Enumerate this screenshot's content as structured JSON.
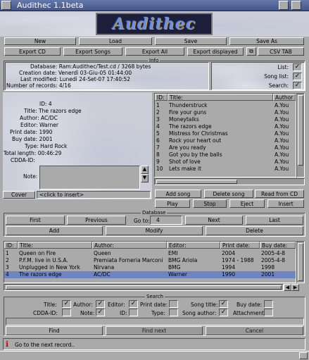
{
  "window": {
    "title": "Audithec 1.1beta"
  },
  "logo": {
    "text": "Audithec"
  },
  "toolbar": {
    "new": "New",
    "load": "Load",
    "save": "Save",
    "save_as": "Save As",
    "export_cd": "Export CD",
    "export_songs": "Export Songs",
    "export_all": "Export All",
    "export_displayed": "Export displayed",
    "csv_tab": "CSV TAB"
  },
  "info": {
    "group_title": "Info",
    "database": "Database: Ram:Audithec/Test.cd / 3268 bytes",
    "creation": "Creation date: Venerdì 03-Giu-05 01:44:00",
    "modified": "Last modified: Lunedì 24-Set-07 17:40:52",
    "records": "Number of records: 4/16",
    "list_label": "List:",
    "songlist_label": "Song list:",
    "search_label": "Search:"
  },
  "record": {
    "id": "ID: 4",
    "title": "Title: The razors edge",
    "author": "Author: AC/DC",
    "editor": "Editor: Warner",
    "print_date": "Print date: 1990",
    "buy_date": "Buy date: 2001",
    "type": "Type: Hard Rock",
    "total_length": "Total length: 00:46:29",
    "cdda_id": "CDDA-ID:",
    "note_label": "Note:",
    "cover_button": "Cover",
    "cover_hint": "<click to insert>"
  },
  "songs": {
    "headers": {
      "id": "ID:",
      "title": "Title:",
      "author": "Author"
    },
    "rows": [
      {
        "id": "1",
        "title": "Thunderstruck",
        "author": "A.You"
      },
      {
        "id": "2",
        "title": "Fire your guns",
        "author": "A.You"
      },
      {
        "id": "3",
        "title": "Moneytalks",
        "author": "A.You"
      },
      {
        "id": "4",
        "title": "The razors edge",
        "author": "A.You"
      },
      {
        "id": "5",
        "title": "Mistress for Christmas",
        "author": "A.You"
      },
      {
        "id": "6",
        "title": "Rock your heart out",
        "author": "A.You"
      },
      {
        "id": "7",
        "title": "Are you ready",
        "author": "A.You"
      },
      {
        "id": "8",
        "title": "Got you by the balls",
        "author": "A.You"
      },
      {
        "id": "9",
        "title": "Shot of love",
        "author": "A.You"
      },
      {
        "id": "10",
        "title": "Lets make it",
        "author": "A.You"
      }
    ],
    "add_song": "Add song",
    "delete_song": "Delete song",
    "read_cd": "Read from CD",
    "play": "Play",
    "stop": "Stop",
    "eject": "Eject",
    "insert": "Insert"
  },
  "database": {
    "group_title": "Database",
    "first": "First",
    "previous": "Previous",
    "goto_label": "Go to:",
    "goto_value": "4",
    "next": "Next",
    "last": "Last",
    "add": "Add",
    "modify": "Modify",
    "delete": "Delete"
  },
  "records": {
    "headers": {
      "id": "ID:",
      "title": "Title:",
      "author": "Author:",
      "editor": "Editor:",
      "print": "Print date:",
      "buy": "Buy date:"
    },
    "rows": [
      {
        "id": "1",
        "title": "Queen on Fire",
        "author": "Queen",
        "editor": "EMI",
        "print": "2004",
        "buy": "2005-4-8"
      },
      {
        "id": "2",
        "title": "P.F.M. live in U.S.A.",
        "author": "Premiata Forneria Marconi",
        "editor": "BMG Ariola",
        "print": "1974 - 1988",
        "buy": "2005-4-8"
      },
      {
        "id": "3",
        "title": "Unplugged in New York",
        "author": "Nirvana",
        "editor": "BMG",
        "print": "1994",
        "buy": "1998"
      },
      {
        "id": "4",
        "title": "The razors edge",
        "author": "AC/DC",
        "editor": "Warner",
        "print": "1990",
        "buy": "2001"
      }
    ]
  },
  "search": {
    "group_title": "Search",
    "title": "Title:",
    "author": "Author:",
    "editor": "Editor:",
    "print_date": "Print date:",
    "song_title": "Song title:",
    "buy_date": "Buy date:",
    "cdda_id": "CDDA-ID:",
    "note": "Note:",
    "id": "ID:",
    "type": "Type:",
    "song_author": "Song author:",
    "attachment": "Attachment:",
    "find": "Find",
    "find_next": "Find next",
    "cancel": "Cancel"
  },
  "status": {
    "text": "Go to the next record.."
  },
  "colors": {
    "titlebar": "#445588",
    "selection": "#6d85c2",
    "panel": "#aaaaaa",
    "marble": "#cbced9"
  }
}
